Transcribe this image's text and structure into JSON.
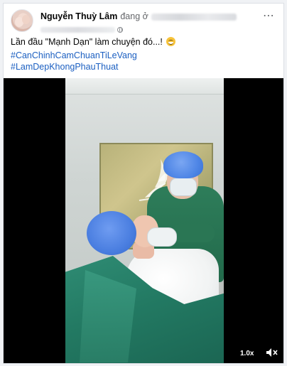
{
  "post": {
    "author_name": "Nguyễn Thuỳ Lâm",
    "is_at_text": "đang ở",
    "caption": "Lần đầu \"Mạnh Dạn\" làm chuyện đó...!",
    "more_icon": "⋯",
    "emoji": "smiling-face-icon",
    "hashtags": [
      "#CanChinhCamChuanTiLeVang",
      "#LamDepKhongPhauThuat"
    ]
  },
  "video": {
    "speed_label": "1.0x",
    "volume_icon": "volume-muted-icon"
  },
  "colors": {
    "hashtag": "#1b5fc1",
    "scrubs": "#226a4b",
    "cap": "#4a7ee0",
    "drape": "#237a63"
  }
}
